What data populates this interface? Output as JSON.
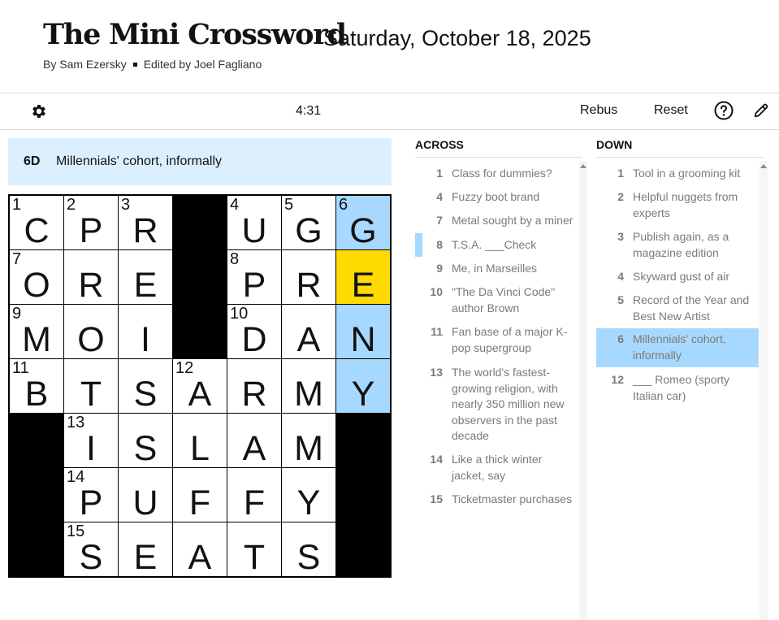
{
  "header": {
    "title": "The Mini Crossword",
    "date": "Saturday, October 18, 2025",
    "author": "By Sam Ezersky",
    "editor": "Edited by Joel Fagliano"
  },
  "toolbar": {
    "timer": "4:31",
    "rebus_label": "Rebus",
    "reset_label": "Reset",
    "icons": [
      "gear-icon",
      "help-icon",
      "pencil-icon"
    ]
  },
  "current_clue": {
    "number": "6D",
    "text": "Millennials' cohort, informally"
  },
  "colors": {
    "highlight": "#a7d8ff",
    "selected": "#ffda00",
    "clue_bar": "#dcefff"
  },
  "grid": {
    "rows": [
      [
        {
          "n": "1",
          "l": "C"
        },
        {
          "n": "2",
          "l": "P"
        },
        {
          "n": "3",
          "l": "R"
        },
        {
          "black": true
        },
        {
          "n": "4",
          "l": "U"
        },
        {
          "n": "5",
          "l": "G"
        },
        {
          "n": "6",
          "l": "G",
          "state": "hl"
        }
      ],
      [
        {
          "n": "7",
          "l": "O"
        },
        {
          "n": "",
          "l": "R"
        },
        {
          "n": "",
          "l": "E"
        },
        {
          "black": true
        },
        {
          "n": "8",
          "l": "P"
        },
        {
          "n": "",
          "l": "R"
        },
        {
          "n": "",
          "l": "E",
          "state": "sel"
        }
      ],
      [
        {
          "n": "9",
          "l": "M"
        },
        {
          "n": "",
          "l": "O"
        },
        {
          "n": "",
          "l": "I"
        },
        {
          "black": true
        },
        {
          "n": "10",
          "l": "D"
        },
        {
          "n": "",
          "l": "A"
        },
        {
          "n": "",
          "l": "N",
          "state": "hl"
        }
      ],
      [
        {
          "n": "11",
          "l": "B"
        },
        {
          "n": "",
          "l": "T"
        },
        {
          "n": "",
          "l": "S"
        },
        {
          "n": "12",
          "l": "A"
        },
        {
          "n": "",
          "l": "R"
        },
        {
          "n": "",
          "l": "M"
        },
        {
          "n": "",
          "l": "Y",
          "state": "hl"
        }
      ],
      [
        {
          "black": true
        },
        {
          "n": "13",
          "l": "I"
        },
        {
          "n": "",
          "l": "S"
        },
        {
          "n": "",
          "l": "L"
        },
        {
          "n": "",
          "l": "A"
        },
        {
          "n": "",
          "l": "M"
        },
        {
          "black": true
        }
      ],
      [
        {
          "black": true
        },
        {
          "n": "14",
          "l": "P"
        },
        {
          "n": "",
          "l": "U"
        },
        {
          "n": "",
          "l": "F"
        },
        {
          "n": "",
          "l": "F"
        },
        {
          "n": "",
          "l": "Y"
        },
        {
          "black": true
        }
      ],
      [
        {
          "black": true
        },
        {
          "n": "15",
          "l": "S"
        },
        {
          "n": "",
          "l": "E"
        },
        {
          "n": "",
          "l": "A"
        },
        {
          "n": "",
          "l": "T"
        },
        {
          "n": "",
          "l": "S"
        },
        {
          "black": true
        }
      ]
    ]
  },
  "across": {
    "heading": "ACROSS",
    "clues": [
      {
        "n": "1",
        "t": "Class for dummies?"
      },
      {
        "n": "4",
        "t": "Fuzzy boot brand"
      },
      {
        "n": "7",
        "t": "Metal sought by a miner"
      },
      {
        "n": "8",
        "t": "T.S.A. ___Check",
        "cross": true
      },
      {
        "n": "9",
        "t": "Me, in Marseilles"
      },
      {
        "n": "10",
        "t": "\"The Da Vinci Code\" author Brown"
      },
      {
        "n": "11",
        "t": "Fan base of a major K-pop supergroup"
      },
      {
        "n": "13",
        "t": "The world's fastest-growing religion, with nearly 350 million new observers in the past decade"
      },
      {
        "n": "14",
        "t": "Like a thick winter jacket, say"
      },
      {
        "n": "15",
        "t": "Ticketmaster purchases"
      }
    ]
  },
  "down": {
    "heading": "DOWN",
    "clues": [
      {
        "n": "1",
        "t": "Tool in a grooming kit"
      },
      {
        "n": "2",
        "t": "Helpful nuggets from experts"
      },
      {
        "n": "3",
        "t": "Publish again, as a magazine edition"
      },
      {
        "n": "4",
        "t": "Skyward gust of air"
      },
      {
        "n": "5",
        "t": "Record of the Year and Best New Artist"
      },
      {
        "n": "6",
        "t": "Millennials' cohort, informally",
        "active": true
      },
      {
        "n": "12",
        "t": "___ Romeo (sporty Italian car)"
      }
    ]
  }
}
